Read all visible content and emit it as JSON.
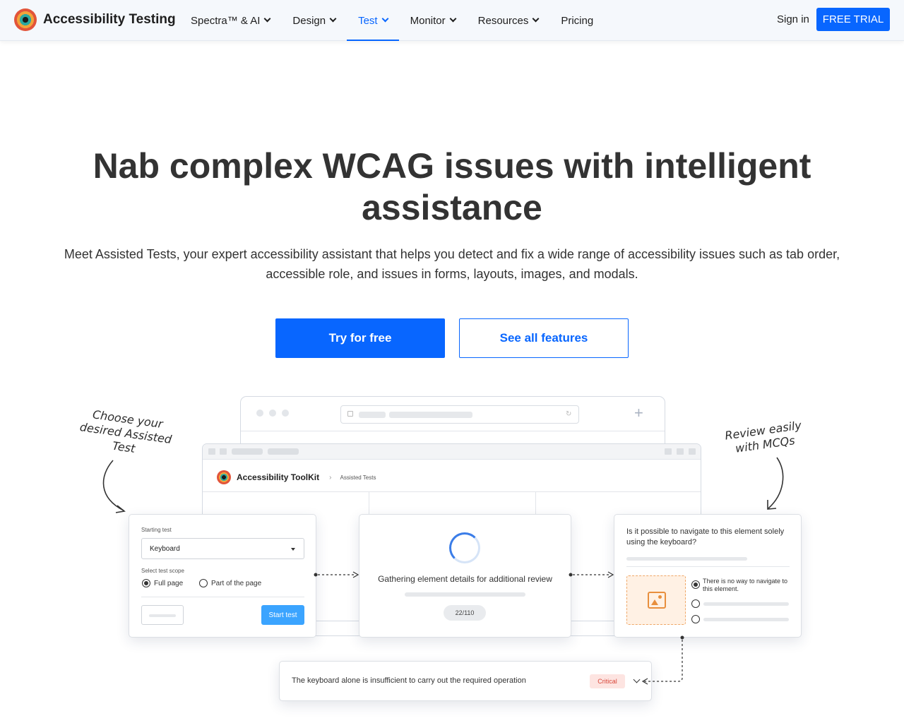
{
  "header": {
    "brand": "Accessibility Testing",
    "menu": [
      {
        "label": "Spectra™ & AI",
        "dropdown": true
      },
      {
        "label": "Design",
        "dropdown": true
      },
      {
        "label": "Test",
        "dropdown": true,
        "active": true
      },
      {
        "label": "Monitor",
        "dropdown": true
      },
      {
        "label": "Resources",
        "dropdown": true
      },
      {
        "label": "Pricing",
        "dropdown": false
      }
    ],
    "signin": "Sign in",
    "trial": "FREE TRIAL"
  },
  "hero": {
    "title": "Nab complex WCAG issues with intelligent assistance",
    "subtitle": "Meet Assisted Tests, your expert accessibility assistant that helps you detect and fix a wide range of accessibility issues such as tab order, accessible role, and issues in forms, layouts, images, and modals.",
    "cta_primary": "Try for free",
    "cta_secondary": "See all features"
  },
  "illustration": {
    "note_left": "Choose your desired Assisted Test",
    "note_right": "Review easily with MCQs",
    "toolkit_name": "Accessibility ToolKit",
    "breadcrumb": "Assisted Tests",
    "card1": {
      "starting_test_label": "Starting test",
      "select_value": "Keyboard",
      "scope_label": "Select test scope",
      "option_full": "Full page",
      "option_part": "Part of the page",
      "start_button": "Start test"
    },
    "card2": {
      "status": "Gathering element details for additional review",
      "progress": "22/110"
    },
    "card3": {
      "question": "Is it possible to navigate to this element solely using the keyboard?",
      "answer": "There is no way to navigate to this element."
    },
    "card4": {
      "issue": "The keyboard alone is insufficient to carry out the required operation",
      "severity": "Critical"
    }
  },
  "colors": {
    "primary": "#0866ff",
    "critical": "#d9473a"
  }
}
